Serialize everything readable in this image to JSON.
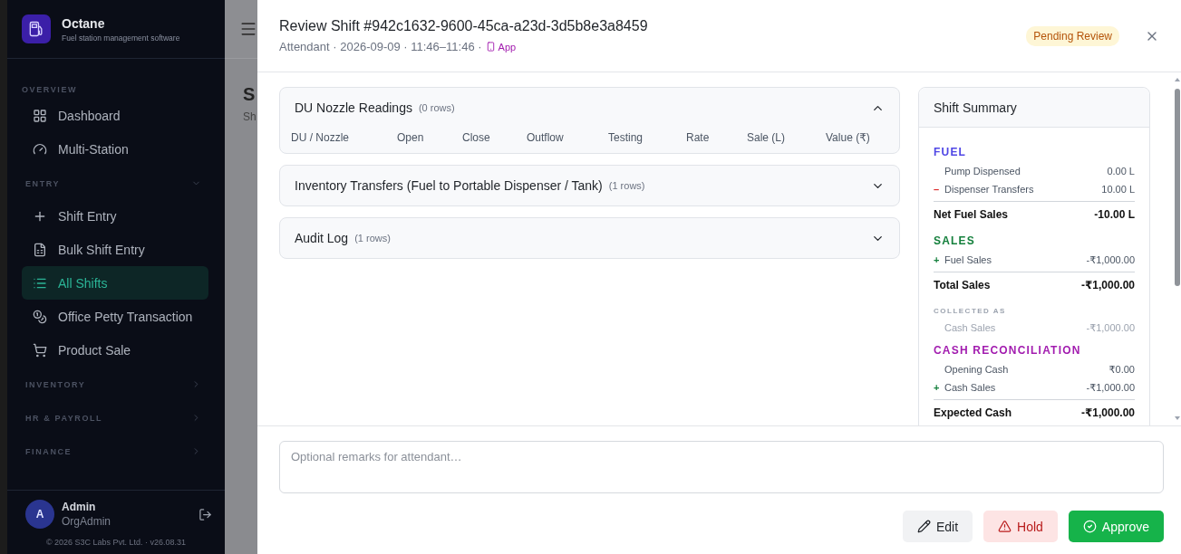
{
  "sidebar": {
    "brand": {
      "name": "Octane",
      "tagline": "Fuel station management software"
    },
    "sections": [
      {
        "label": "OVERVIEW",
        "kind": "static",
        "items": [
          {
            "label": "Dashboard",
            "selected": false
          },
          {
            "label": "Multi-Station",
            "selected": false
          }
        ]
      },
      {
        "label": "ENTRY",
        "kind": "collapsible",
        "expanded": true,
        "items": [
          {
            "label": "Shift Entry",
            "selected": false
          },
          {
            "label": "Bulk Shift Entry",
            "selected": false
          },
          {
            "label": "All Shifts",
            "selected": true
          },
          {
            "label": "Office Petty Transaction",
            "selected": false
          },
          {
            "label": "Product Sale",
            "selected": false
          }
        ]
      },
      {
        "label": "INVENTORY",
        "kind": "collapsible",
        "expanded": false
      },
      {
        "label": "HR & PAYROLL",
        "kind": "collapsible",
        "expanded": false
      },
      {
        "label": "FINANCE",
        "kind": "collapsible",
        "expanded": false
      }
    ],
    "user": {
      "initial": "A",
      "name": "Admin",
      "role": "OrgAdmin"
    },
    "footer": "© 2026 S3C Labs Pvt. Ltd. · v26.08.31"
  },
  "background_page": {
    "title": "S",
    "subtitle": "Sh"
  },
  "dialog": {
    "title": "Review Shift #942c1632-9600-45ca-a23d-3d5b8e3a8459",
    "meta": "Attendant · 2026-09-09 · 11:46–11:46 ·",
    "source": "App",
    "status": "Pending Review",
    "panels": [
      {
        "title": "DU Nozzle Readings",
        "count": "(0 rows)",
        "expanded": true,
        "columns": [
          "DU / Nozzle",
          "Open",
          "Close",
          "Outflow",
          "Testing",
          "Rate",
          "Sale (L)",
          "Value (₹)"
        ]
      },
      {
        "title": "Inventory Transfers (Fuel to Portable Dispenser / Tank)",
        "count": "(1 rows)",
        "expanded": false
      },
      {
        "title": "Audit Log",
        "count": "(1 rows)",
        "expanded": false
      }
    ],
    "summary": {
      "title": "Shift Summary",
      "sections": [
        {
          "title": "FUEL",
          "kind": "group",
          "color": "#4f46e5",
          "rows": [
            {
              "kind": "item",
              "label": "Pump Dispensed",
              "value": "0.00 L"
            },
            {
              "kind": "item",
              "color": "#dc2626",
              "sign": "–",
              "label": "Dispenser Transfers",
              "value": "10.00 L"
            },
            {
              "kind": "total",
              "label": "Net Fuel Sales",
              "value": "-10.00 L"
            }
          ]
        },
        {
          "title": "SALES",
          "kind": "group",
          "color": "#15803d",
          "rows": [
            {
              "kind": "item",
              "color": "#15803d",
              "sign": "+",
              "label": "Fuel Sales",
              "value": "-₹1,000.00"
            },
            {
              "kind": "total",
              "label": "Total Sales",
              "value": "-₹1,000.00"
            }
          ]
        },
        {
          "title": "COLLECTED AS",
          "kind": "subgroup",
          "color": "#9ca3af",
          "rows": [
            {
              "kind": "muted",
              "label": "Cash Sales",
              "value": "-₹1,000.00"
            }
          ]
        },
        {
          "title": "CASH RECONCILIATION",
          "kind": "group",
          "color": "#a21caf",
          "rows": [
            {
              "kind": "item",
              "label": "Opening Cash",
              "value": "₹0.00"
            },
            {
              "kind": "item",
              "color": "#15803d",
              "sign": "+",
              "label": "Cash Sales",
              "value": "-₹1,000.00"
            },
            {
              "kind": "total",
              "label": "Expected Cash",
              "value": "-₹1,000.00"
            }
          ]
        }
      ]
    },
    "remarks": {
      "placeholder": "Optional remarks for attendant…"
    },
    "actions": [
      {
        "kind": "edit",
        "label": "Edit"
      },
      {
        "kind": "hold",
        "label": "Hold"
      },
      {
        "kind": "approve",
        "label": "Approve"
      }
    ]
  }
}
